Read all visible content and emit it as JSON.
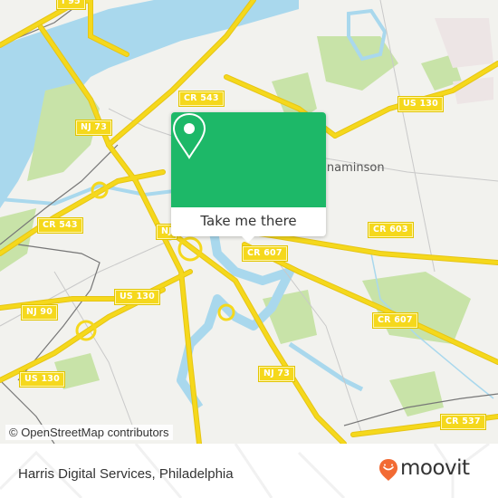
{
  "map": {
    "colors": {
      "land": "#f2f2ee",
      "water": "#a9d8ed",
      "park": "#c8e3a8",
      "road": "#f5d81c",
      "road_casing": "#e6c514",
      "minor_road": "#c9c9c9",
      "rail": "#777777"
    },
    "road_labels": [
      {
        "id": "i95",
        "text": "I 95"
      },
      {
        "id": "nj73-north",
        "text": "NJ 73"
      },
      {
        "id": "cr543-north",
        "text": "CR 543"
      },
      {
        "id": "us130-east",
        "text": "US 130"
      },
      {
        "id": "cr543-west",
        "text": "CR 543"
      },
      {
        "id": "nj-partial",
        "text": "NJ"
      },
      {
        "id": "cr607-center",
        "text": "CR 607"
      },
      {
        "id": "cr603",
        "text": "CR 603"
      },
      {
        "id": "us130-center",
        "text": "US 130"
      },
      {
        "id": "cr607-east",
        "text": "CR 607"
      },
      {
        "id": "nj90",
        "text": "NJ 90"
      },
      {
        "id": "nj73-south",
        "text": "NJ 73"
      },
      {
        "id": "us130-west",
        "text": "US 130"
      },
      {
        "id": "cr537",
        "text": "CR 537"
      }
    ],
    "town_label": "Cinnaminson",
    "attribution": "© OpenStreetMap contributors"
  },
  "popup": {
    "icon": "map-pin-icon",
    "button_label": "Take me there",
    "accent_color": "#1db868"
  },
  "footer": {
    "place_name": "Harris Digital Services, Philadelphia",
    "brand": {
      "name": "moovit",
      "logo_icon": "moovit-pin-smile-icon",
      "logo_color": "#f26a33"
    }
  }
}
